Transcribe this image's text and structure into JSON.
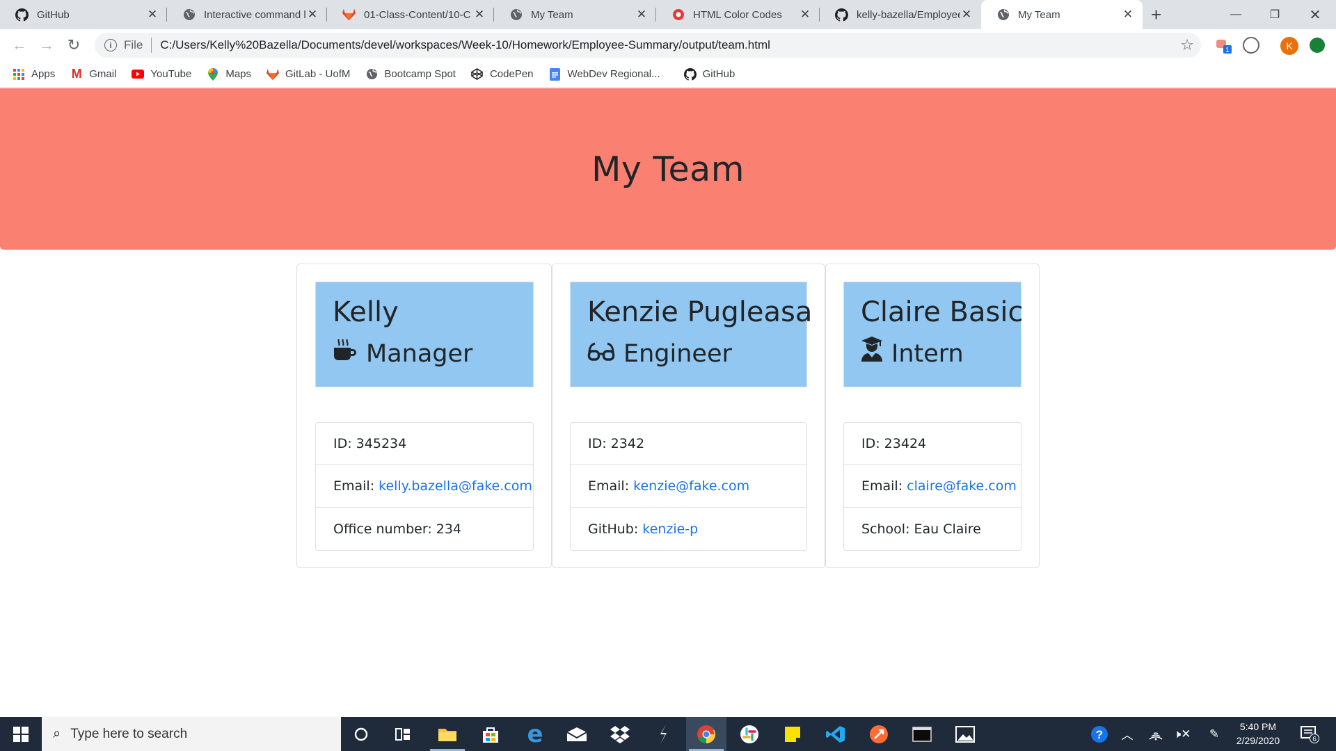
{
  "browser": {
    "tabs": [
      {
        "title": "GitHub",
        "icon": "github-icon"
      },
      {
        "title": "Interactive command li",
        "icon": "globe-icon"
      },
      {
        "title": "01-Class-Content/10-C",
        "icon": "gitlab-icon"
      },
      {
        "title": "My Team",
        "icon": "globe-icon"
      },
      {
        "title": "HTML Color Codes",
        "icon": "html-color-codes-icon"
      },
      {
        "title": "kelly-bazella/Employee",
        "icon": "github-icon"
      },
      {
        "title": "My Team",
        "icon": "globe-icon",
        "active": true
      }
    ],
    "address": {
      "scheme": "File",
      "url": "C:/Users/Kelly%20Bazella/Documents/devel/workspaces/Week-10/Homework/Employee-Summary/output/team.html"
    },
    "profile_initial": "K",
    "extension_badge": "1",
    "bookmarks": [
      {
        "label": "Apps",
        "icon": "apps-grid-icon"
      },
      {
        "label": "Gmail",
        "icon": "gmail-icon"
      },
      {
        "label": "YouTube",
        "icon": "youtube-icon"
      },
      {
        "label": "Maps",
        "icon": "maps-icon"
      },
      {
        "label": "GitLab - UofM",
        "icon": "gitlab-icon"
      },
      {
        "label": "Bootcamp Spot",
        "icon": "globe-icon"
      },
      {
        "label": "CodePen",
        "icon": "codepen-icon"
      },
      {
        "label": "WebDev Regional...",
        "icon": "docs-icon"
      },
      {
        "label": "GitHub",
        "icon": "github-icon"
      }
    ]
  },
  "page": {
    "title": "My Team",
    "colors": {
      "jumbotron": "#fa8072",
      "card_header": "#91c7f0",
      "link": "#1a73e8"
    },
    "employees": [
      {
        "name": "Kelly",
        "role": "Manager",
        "role_icon": "coffee-mug-icon",
        "id": "ID: 345234",
        "email_label": "Email:",
        "email": "kelly.bazella@fake.com",
        "extra_label": "Office number: 234",
        "extra_link": ""
      },
      {
        "name": "Kenzie Pugleasa",
        "role": "Engineer",
        "role_icon": "glasses-icon",
        "id": "ID: 2342",
        "email_label": "Email:",
        "email": "kenzie@fake.com",
        "extra_label": "GitHub:",
        "extra_link": "kenzie-p"
      },
      {
        "name": "Claire Basic",
        "role": "Intern",
        "role_icon": "graduate-icon",
        "id": "ID: 23424",
        "email_label": "Email:",
        "email": "claire@fake.com",
        "extra_label": "School: Eau Claire",
        "extra_link": ""
      }
    ]
  },
  "taskbar": {
    "search_placeholder": "Type here to search",
    "time": "5:40 PM",
    "date": "2/29/2020",
    "notification_count": "6"
  }
}
